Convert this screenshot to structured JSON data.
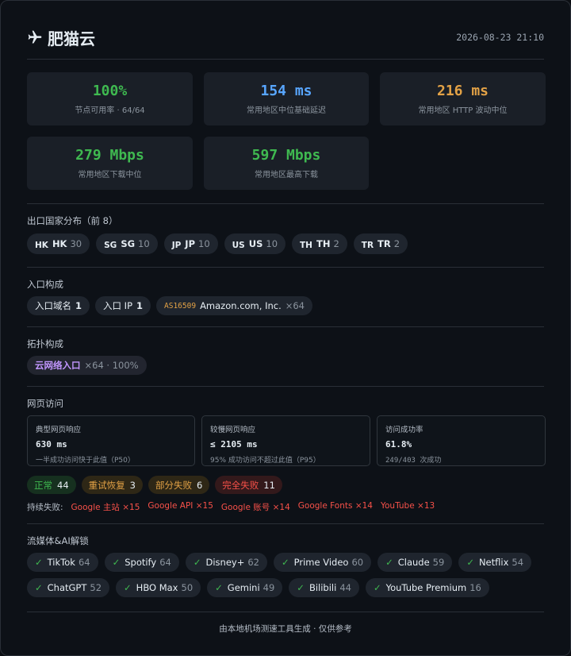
{
  "header": {
    "icon": "airplane-icon",
    "title": "肥猫云",
    "timestamp": "2026-08-23 21:10"
  },
  "stats": [
    {
      "value": "100%",
      "label": "节点可用率 · 64/64",
      "color": "#3fb950"
    },
    {
      "value": "154 ms",
      "label": "常用地区中位基础延迟",
      "color": "#58a6ff"
    },
    {
      "value": "216 ms",
      "label": "常用地区 HTTP 波动中位",
      "color": "#e3a246"
    },
    {
      "value": "279 Mbps",
      "label": "常用地区下载中位",
      "color": "#3fb950"
    },
    {
      "value": "597 Mbps",
      "label": "常用地区最高下载",
      "color": "#3fb950"
    }
  ],
  "countries": {
    "title": "出口国家分布（前 8）",
    "items": [
      {
        "flag": "HK",
        "code": "HK",
        "count": "30"
      },
      {
        "flag": "SG",
        "code": "SG",
        "count": "10"
      },
      {
        "flag": "JP",
        "code": "JP",
        "count": "10"
      },
      {
        "flag": "US",
        "code": "US",
        "count": "10"
      },
      {
        "flag": "TH",
        "code": "TH",
        "count": "2"
      },
      {
        "flag": "TR",
        "code": "TR",
        "count": "2"
      }
    ]
  },
  "entry": {
    "title": "入口构成",
    "domain_label": "入口域名",
    "domain_count": "1",
    "ip_label": "入口 IP",
    "ip_count": "1",
    "asn": "AS16509",
    "asn_name": "Amazon.com, Inc.",
    "asn_count": "×64"
  },
  "topology": {
    "title": "拓扑构成",
    "label": "云网络入口",
    "detail": "×64 · 100%"
  },
  "web": {
    "title": "网页访问",
    "boxes": [
      {
        "key": "典型网页响应",
        "value": "630 ms",
        "note": "一半成功访问快于此值（P50）"
      },
      {
        "key": "较慢网页响应",
        "value": "≤ 2105 ms",
        "note": "95% 成功访问不超过此值（P95）"
      },
      {
        "key": "访问成功率",
        "value": "61.8%",
        "note": "249/403 次成功"
      }
    ],
    "statuses": [
      {
        "label": "正常",
        "count": "44"
      },
      {
        "label": "重试恢复",
        "count": "3"
      },
      {
        "label": "部分失败",
        "count": "6"
      },
      {
        "label": "完全失败",
        "count": "11"
      }
    ],
    "fail_label": "持续失败:",
    "fails": [
      "Google 主站 ×15",
      "Google API ×15",
      "Google 账号 ×14",
      "Google Fonts ×14",
      "YouTube ×13"
    ]
  },
  "streaming": {
    "title": "流媒体&AI解锁",
    "check": "✓",
    "row1": [
      {
        "name": "TikTok",
        "count": "64"
      },
      {
        "name": "Spotify",
        "count": "64"
      },
      {
        "name": "Disney+",
        "count": "62"
      },
      {
        "name": "Prime Video",
        "count": "60"
      },
      {
        "name": "Claude",
        "count": "59"
      },
      {
        "name": "Netflix",
        "count": "54"
      }
    ],
    "row2": [
      {
        "name": "ChatGPT",
        "count": "52"
      },
      {
        "name": "HBO Max",
        "count": "50"
      },
      {
        "name": "Gemini",
        "count": "49"
      },
      {
        "name": "Bilibili",
        "count": "44"
      },
      {
        "name": "YouTube Premium",
        "count": "16"
      }
    ]
  },
  "footer": "由本地机场测速工具生成 · 仅供参考"
}
